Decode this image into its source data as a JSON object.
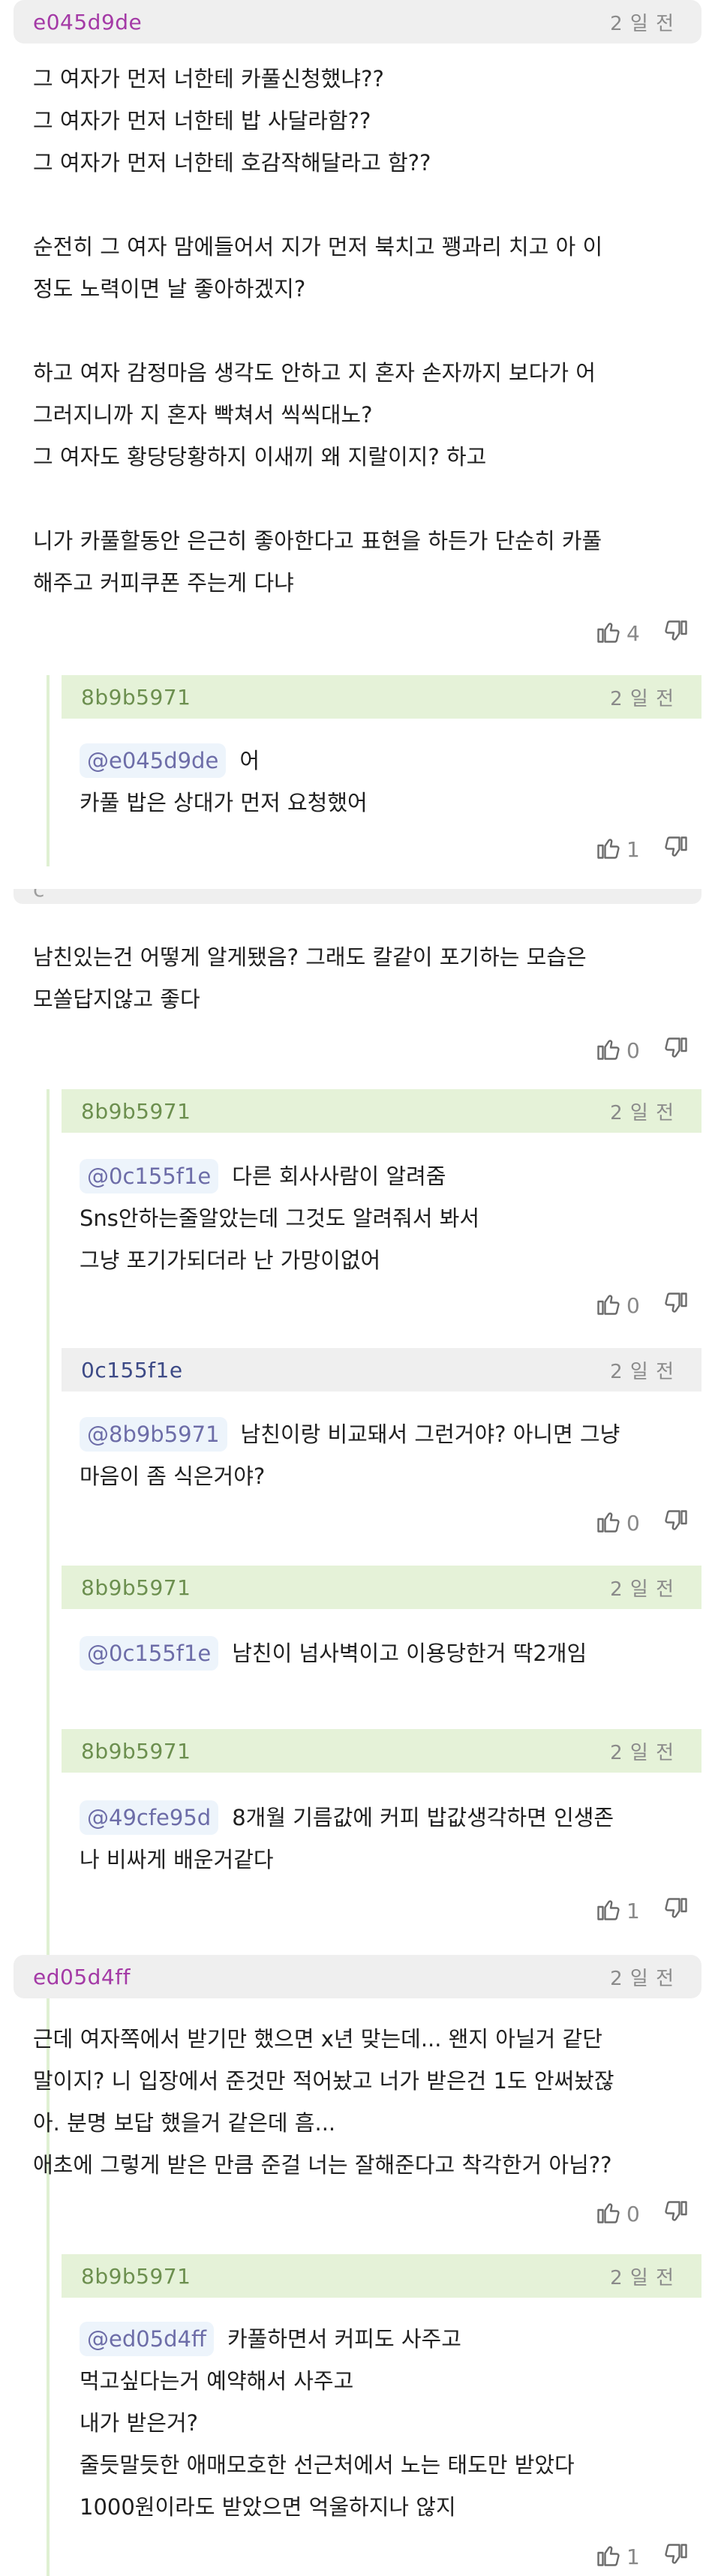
{
  "comments": [
    {
      "user": "e045d9de",
      "time": "2 일 전",
      "lines": [
        "그 여자가 먼저 너한테 카풀신청했냐??",
        "그 여자가 먼저 너한테 밥 사달라함??",
        "그 여자가 먼저 너한테 호감작해달라고 함??",
        "",
        "순전히 그 여자 맘에들어서 지가 먼저 북치고 꽹과리 치고 아 이",
        "정도 노력이면 날 좋아하겠지?",
        "",
        "하고 여자 감정마음 생각도 안하고 지 혼자 손자까지 보다가 어",
        "그러지니까 지 혼자 빡쳐서 씩씩대노?",
        "그 여자도 황당당황하지 이새끼 왜 지랄이지? 하고",
        "",
        "니가 카풀할동안 은근히 좋아한다고 표현을 하든가 단순히 카풀",
        "해주고 커피쿠폰 주는게 다냐"
      ],
      "likes": "4"
    },
    {
      "user": "8b9b5971",
      "time": "2 일 전",
      "mention": "@e045d9de",
      "lines": [
        "어",
        "카풀 밥은 상대가 먼저 요청했어"
      ],
      "likes": "1"
    },
    {
      "lines": [
        "남친있는건 어떻게 알게됐음? 그래도 칼같이 포기하는 모습은",
        "모쏠답지않고 좋다"
      ],
      "likes": "0"
    },
    {
      "user": "8b9b5971",
      "time": "2 일 전",
      "mention": "@0c155f1e",
      "lines": [
        "다른 회사사람이 알려줌",
        "Sns안하는줄알았는데 그것도 알려줘서 봐서",
        "그냥 포기가되더라 난 가망이없어"
      ],
      "likes": "0"
    },
    {
      "user": "0c155f1e",
      "time": "2 일 전",
      "mention": "@8b9b5971",
      "lines": [
        "남친이랑 비교돼서 그런거야? 아니면 그냥",
        "마음이 좀 식은거야?"
      ],
      "likes": "0"
    },
    {
      "user": "8b9b5971",
      "time": "2 일 전",
      "mention": "@0c155f1e",
      "lines": [
        "남친이 넘사벽이고 이용당한거 딱2개임"
      ]
    },
    {
      "user": "8b9b5971",
      "time": "2 일 전",
      "mention": "@49cfe95d",
      "lines": [
        "8개월 기름값에 커피 밥값생각하면 인생존",
        "나 비싸게 배운거같다"
      ],
      "likes": "1"
    },
    {
      "user": "ed05d4ff",
      "time": "2 일 전",
      "lines": [
        "근데 여자쪽에서 받기만 했으면 x년 맞는데... 왠지 아닐거 같단",
        "말이지? 니 입장에서 준것만 적어놨고 너가 받은건 1도 안써놨잖",
        "아. 분명 보답 했을거 같은데 흠...",
        "애초에 그렇게 받은 만큼 준걸 너는 잘해준다고 착각한거 아님??"
      ],
      "likes": "0"
    },
    {
      "user": "8b9b5971",
      "time": "2 일 전",
      "mention": "@ed05d4ff",
      "lines": [
        "카풀하면서 커피도 사주고",
        "먹고싶다는거 예약해서 사주고",
        "내가 받은거?",
        "줄듯말듯한 애매모호한 선근처에서 노는 태도만 받았다",
        "1000원이라도 받았으면 억울하지나 않지"
      ],
      "likes": "1"
    }
  ],
  "icons": {
    "like": "thumbs-up-icon",
    "dislike": "thumbs-down-icon"
  },
  "colors": {
    "main_user": "#a43aa6",
    "reply_user": "#6c8f4f",
    "reply_gray_user": "#3d4a86",
    "time": "#8a8a8a",
    "mention_bg": "#edf4fb"
  }
}
